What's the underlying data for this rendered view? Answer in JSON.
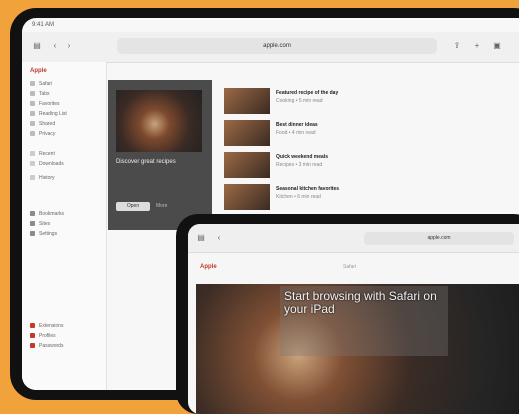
{
  "status_time": "9:41 AM",
  "back_browser": {
    "url": "apple.com",
    "sidebar_title": "Apple",
    "sidebar_items": [
      "Safari",
      "Tabs",
      "Favorites",
      "Reading List",
      "Shared",
      "Privacy",
      "Recent",
      "Downloads",
      "History",
      "Bookmarks",
      "Sites",
      "Settings",
      "Extensions",
      "Profiles",
      "Passwords"
    ],
    "featured": {
      "title": "Discover great recipes",
      "button": "Open",
      "more": "More"
    },
    "articles": [
      {
        "title": "Featured recipe of the day",
        "sub": "Cooking • 5 min read"
      },
      {
        "title": "Best dinner ideas",
        "sub": "Food • 4 min read"
      },
      {
        "title": "Quick weekend meals",
        "sub": "Recipes • 3 min read"
      },
      {
        "title": "Seasonal kitchen favorites",
        "sub": "Kitchen • 6 min read"
      }
    ]
  },
  "front_browser": {
    "url": "apple.com",
    "header": "Apple",
    "center": "Safari",
    "hero_text": "Start browsing with Safari on your iPad"
  }
}
